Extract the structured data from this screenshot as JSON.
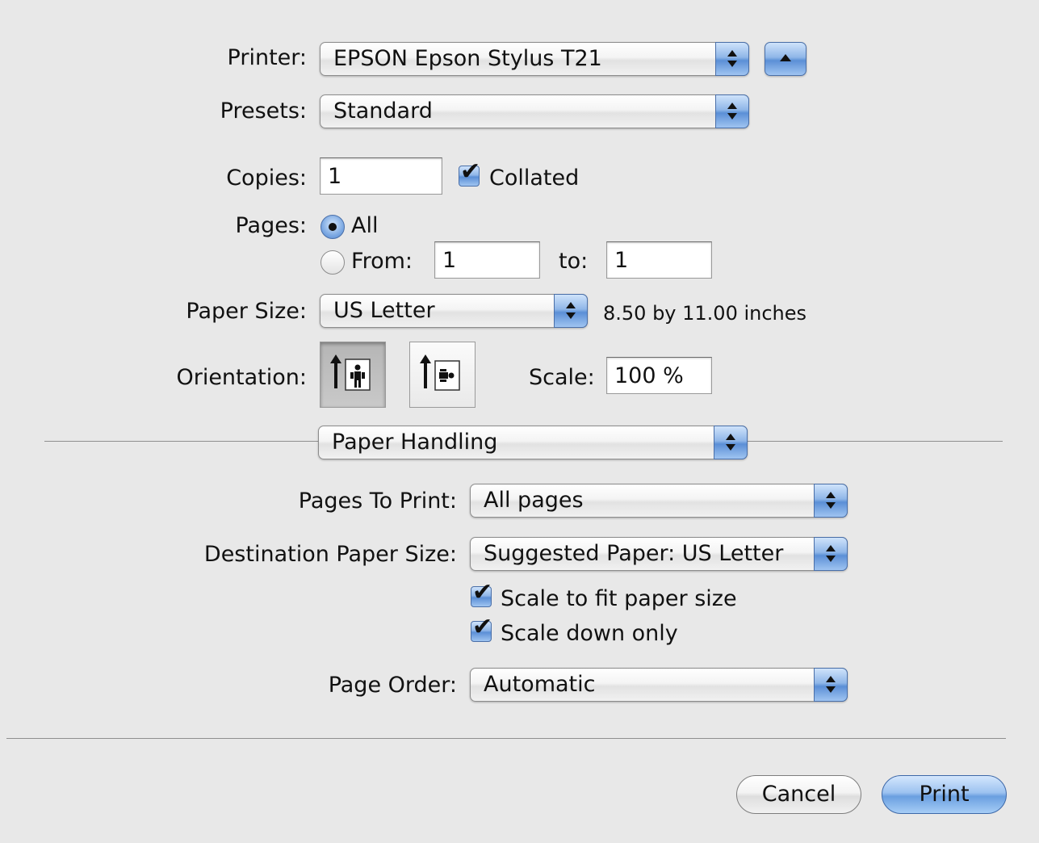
{
  "printer": {
    "label": "Printer:",
    "value": "EPSON Epson Stylus T21"
  },
  "presets": {
    "label": "Presets:",
    "value": "Standard"
  },
  "copies": {
    "label": "Copies:",
    "value": "1",
    "collated_label": "Collated",
    "collated_checked": true
  },
  "pages": {
    "label": "Pages:",
    "all_label": "All",
    "from_label": "From:",
    "from_value": "1",
    "to_label": "to:",
    "to_value": "1",
    "selected": "All"
  },
  "paper_size": {
    "label": "Paper Size:",
    "value": "US Letter",
    "dimensions": "8.50 by 11.00 inches"
  },
  "orientation": {
    "label": "Orientation:",
    "selected": "portrait",
    "portrait_icon": "portrait-person-icon",
    "landscape_icon": "landscape-person-icon"
  },
  "scale": {
    "label": "Scale:",
    "value": "100 %"
  },
  "section": {
    "value": "Paper Handling"
  },
  "paper_handling": {
    "pages_to_print_label": "Pages To Print:",
    "pages_to_print_value": "All pages",
    "destination_label": "Destination Paper Size:",
    "destination_value": "Suggested Paper: US Letter",
    "scale_to_fit_label": "Scale to fit paper size",
    "scale_to_fit_checked": true,
    "scale_down_label": "Scale down only",
    "scale_down_checked": true,
    "page_order_label": "Page Order:",
    "page_order_value": "Automatic"
  },
  "buttons": {
    "cancel": "Cancel",
    "print": "Print"
  },
  "colors": {
    "background": "#e8e8e8",
    "accent_blue": "#6a9fe0"
  }
}
